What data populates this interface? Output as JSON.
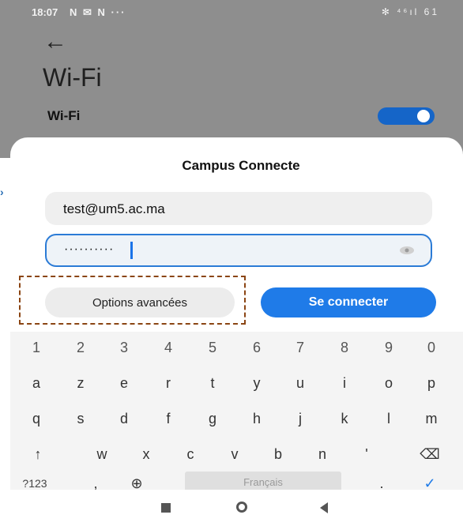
{
  "status": {
    "time": "18:07",
    "notifications": "N ✉ N ···",
    "right_icons": "✻ ⁴⁶ıl 61"
  },
  "header": {
    "back_icon": "arrow-left-icon",
    "title": "Wi-Fi",
    "wifi_label": "Wi-Fi",
    "wifi_toggle": "on"
  },
  "dialog": {
    "title": "Campus Connecte",
    "username_value": "test@um5.ac.ma",
    "password_value": "··········",
    "advanced_button": "Options avancées",
    "connect_button": "Se connecter"
  },
  "keyboard": {
    "numbers": [
      "1",
      "2",
      "3",
      "4",
      "5",
      "6",
      "7",
      "8",
      "9",
      "0"
    ],
    "row1": [
      "a",
      "z",
      "e",
      "r",
      "t",
      "y",
      "u",
      "i",
      "o",
      "p"
    ],
    "row2": [
      "q",
      "s",
      "d",
      "f",
      "g",
      "h",
      "j",
      "k",
      "l",
      "m"
    ],
    "row3": [
      "w",
      "x",
      "c",
      "v",
      "b",
      "n",
      "'"
    ],
    "symbols_key": "?123",
    "comma_key": ",",
    "space_label": "Français",
    "period_key": "."
  },
  "colors": {
    "accent": "#1f7be8",
    "toggle": "#1565c8",
    "annotation": "#8b4513"
  }
}
